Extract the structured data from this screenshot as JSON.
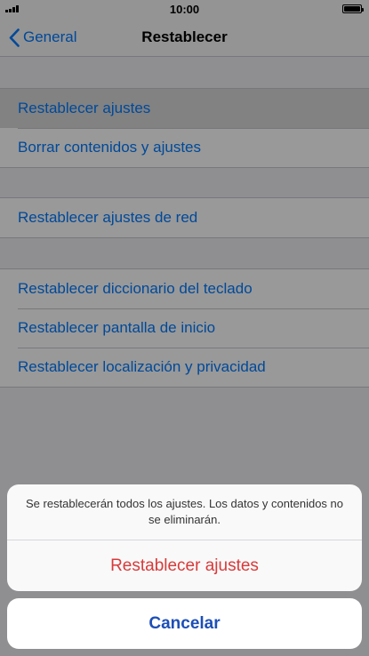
{
  "status_bar": {
    "time": "10:00"
  },
  "nav": {
    "back_label": "General",
    "title": "Restablecer"
  },
  "groups": [
    {
      "items": [
        {
          "label": "Restablecer ajustes"
        },
        {
          "label": "Borrar contenidos y ajustes"
        }
      ]
    },
    {
      "items": [
        {
          "label": "Restablecer ajustes de red"
        }
      ]
    },
    {
      "items": [
        {
          "label": "Restablecer diccionario del teclado"
        },
        {
          "label": "Restablecer pantalla de inicio"
        },
        {
          "label": "Restablecer localización y privacidad"
        }
      ]
    }
  ],
  "action_sheet": {
    "message": "Se restablecerán todos los ajustes. Los datos y contenidos no se eliminarán.",
    "destructive_label": "Restablecer ajustes",
    "cancel_label": "Cancelar"
  },
  "colors": {
    "link": "#007aff",
    "destructive": "#d93a3a",
    "cancel": "#1d4fb6"
  }
}
